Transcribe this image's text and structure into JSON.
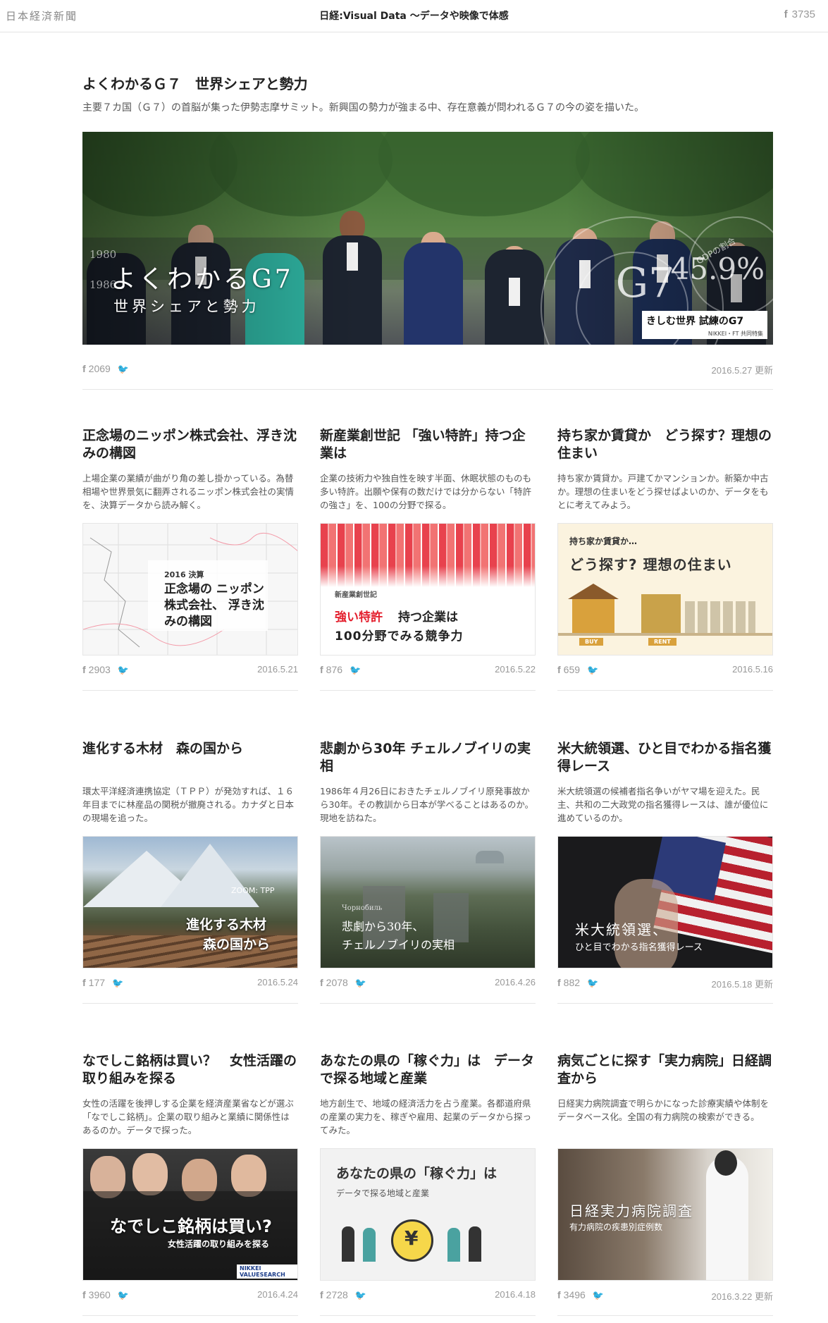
{
  "header": {
    "logo": "日本経済新聞",
    "title": "日経:Visual Data 〜データや映像で体感",
    "share_count": "3735"
  },
  "hero": {
    "title": "よくわかるＧ７　世界シェアと勢力",
    "description": "主要７カ国（Ｇ７）の首脳が集った伊勢志摩サミット。新興国の勢力が強まる中、存在意義が問われるＧ７の今の姿を描いた。",
    "image_title": "よくわかるG7",
    "image_subtitle": "世界シェアと勢力",
    "year1": "1980",
    "year2": "1986",
    "g7_label": "G7",
    "gdp_label": "GDPの割合",
    "gdp_value": "45.9%",
    "badge_title": "きしむ世界 試練のG7",
    "badge_sub": "NIKKEI・FT 共同特集",
    "fb_count": "2069",
    "date": "2016.5.27 更新"
  },
  "cards": [
    {
      "title": "正念場のニッポン株式会社、浮き沈みの構図",
      "description": "上場企業の業績が曲がり角の差し掛かっている。為替相場や世界景気に翻弄されるニッポン株式会社の実情を、決算データから読み解く。",
      "cap_small": "2016 決算",
      "cap_main": "正念場の ニッポン株式会社、 浮き沈みの構図",
      "fb_count": "2903",
      "date": "2016.5.21"
    },
    {
      "title": "新産業創世記 「強い特許」持つ企業は",
      "description": "企業の技術力や独自性を映す半面、休眠状態のものも多い特許。出願や保有の数だけでは分からない「特許の強さ」を、100の分野で探る。",
      "cap_small": "新産業創世記",
      "cap_red": "強い特許",
      "cap_main1": "持つ企業は",
      "cap_main2": "100分野でみる競争力",
      "fb_count": "876",
      "date": "2016.5.22"
    },
    {
      "title": "持ち家か賃貸か　どう探す？理想の住まい",
      "description": "持ち家か賃貸か。戸建てかマンションか。新築か中古か。理想の住まいをどう探せばよいのか、データをもとに考えてみよう。",
      "cap_small": "持ち家か賃貸か…",
      "cap_main": "どう探す? 理想の住まい",
      "buy": "BUY",
      "rent": "RENT",
      "fb_count": "659",
      "date": "2016.5.16"
    },
    {
      "title": "進化する木材　森の国から",
      "description": "環太平洋経済連携協定（ＴＰＰ）が発効すれば、１６年目までに林産品の関税が撤廃される。カナダと日本の現場を追った。",
      "cap_small": "ZOOM: TPP",
      "cap_main1": "進化する木材",
      "cap_main2": "森の国から",
      "fb_count": "177",
      "date": "2016.5.24"
    },
    {
      "title": "悲劇から30年 チェルノブイリの実相",
      "description": "1986年４月26日におきたチェルノブイリ原発事故から30年。その教訓から日本が学べることはあるのか。現地を訪ねた。",
      "cap_small": "Чорнобиль",
      "cap_main1": "悲劇から30年、",
      "cap_main2": "チェルノブイリの実相",
      "fb_count": "2078",
      "date": "2016.4.26"
    },
    {
      "title": "米大統領選、ひと目でわかる指名獲得レース",
      "description": "米大統領選の候補者指名争いがヤマ場を迎えた。民主、共和の二大政党の指名獲得レースは、誰が優位に進めているのか。",
      "cap_main1": "米大統領選、",
      "cap_main2": "ひと目でわかる指名獲得レース",
      "fb_count": "882",
      "date": "2016.5.18 更新"
    },
    {
      "title": "なでしこ銘柄は買い？　女性活躍の取り組みを探る",
      "description": "女性の活躍を後押しする企業を経済産業省などが選ぶ「なでしこ銘柄」。企業の取り組みと業績に関係性はあるのか。データで探った。",
      "cap_main1": "なでしこ銘柄は買い?",
      "cap_main2": "女性活躍の取り組みを探る",
      "cap_logo": "NIKKEI VALUESEARCH",
      "fb_count": "3960",
      "date": "2016.4.24"
    },
    {
      "title": "あなたの県の「稼ぐ力」は　データで探る地域と産業",
      "description": "地方創生で、地域の経済活力を占う産業。各都道府県の産業の実力を、稼ぎや雇用、起業のデータから探ってみた。",
      "cap_main1": "あなたの県の「稼ぐ力」は",
      "cap_main2": "データで探る地域と産業",
      "fb_count": "2728",
      "date": "2016.4.18"
    },
    {
      "title": "病気ごとに探す「実力病院」日経調査から",
      "description": "日経実力病院調査で明らかになった診療実績や体制をデータベース化。全国の有力病院の検索ができる。",
      "cap_main1": "日経実力病院調査",
      "cap_main2": "有力病院の疾患別症例数",
      "fb_count": "3496",
      "date": "2016.3.22 更新"
    }
  ],
  "icons": {
    "facebook": "f",
    "twitter": "🐦"
  }
}
